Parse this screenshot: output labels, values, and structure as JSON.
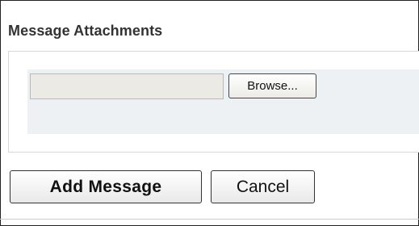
{
  "section": {
    "title": "Message Attachments"
  },
  "attachment": {
    "file_value": "",
    "browse_label": "Browse..."
  },
  "actions": {
    "add_label": "Add Message",
    "cancel_label": "Cancel"
  }
}
